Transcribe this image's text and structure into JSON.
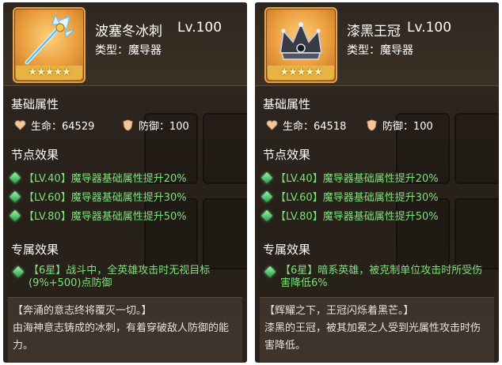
{
  "cards": [
    {
      "name": "波塞冬冰刺",
      "level": "Lv.100",
      "type": "类型：魔导器",
      "stars": "★★★★★",
      "icon": "ice-trident-icon",
      "base_attr_title": "基础属性",
      "hp_text": "生命：64529",
      "def_text": "防御：100",
      "node_title": "节点效果",
      "nodes": [
        "【LV.40】魔导器基础属性提升20%",
        "【LV.60】魔导器基础属性提升30%",
        "【LV.80】魔导器基础属性提升50%"
      ],
      "exclusive_title": "专属效果",
      "exclusive_text": "【6星】战斗中，全英雄攻击时无视目标(9%+500)点防御",
      "lore_quote": "【奔涌的意志终将覆灭一切。】",
      "lore_text": "由海神意志铸成的冰刺，有着穿破敌人防御的能力。"
    },
    {
      "name": "漆黑王冠",
      "level": "Lv.100",
      "type": "类型：魔导器",
      "stars": "★★★★★",
      "icon": "dark-crown-icon",
      "base_attr_title": "基础属性",
      "hp_text": "生命：64518",
      "def_text": "防御：100",
      "node_title": "节点效果",
      "nodes": [
        "【LV.40】魔导器基础属性提升20%",
        "【LV.60】魔导器基础属性提升30%",
        "【LV.80】魔导器基础属性提升50%"
      ],
      "exclusive_title": "专属效果",
      "exclusive_text": "【6星】暗系英雄，被克制单位攻击时所受伤害降低6%",
      "lore_quote": "【辉耀之下，王冠闪烁着黑芒。】",
      "lore_text": "漆黑的王冠，被其加冕之人受到光属性攻击时伤害降低。"
    }
  ],
  "colors": {
    "effect_green": "#7de07a",
    "frame_orange": "#e8a24a",
    "panel_brown": "#2c241e"
  }
}
